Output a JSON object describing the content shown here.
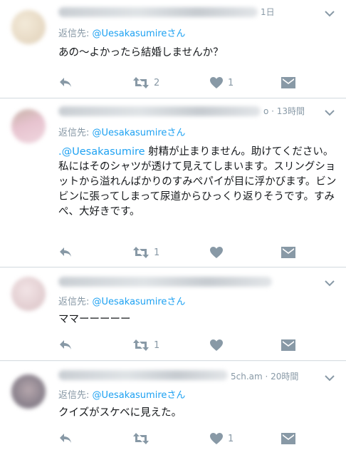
{
  "tweets": [
    {
      "time": "1日",
      "reply_prefix": "返信先: ",
      "reply_handle": "@Uesakasumire",
      "reply_suffix": "さん",
      "text": "あの〜よかったら結婚しませんか？",
      "retweets": "2",
      "likes": "1",
      "avatar_color": "#e9dcc7"
    },
    {
      "time": "o · 13時間",
      "reply_prefix": "返信先: ",
      "reply_handle": "@Uesakasumire",
      "reply_suffix": "さん",
      "mention": ".@Uesakasumire",
      "text": " 射精が止まりません。助けてください。\n私にはそのシャツが透けて見えてしまいます。スリングショットから溢れんばかりのすみぺパイが目に浮かびます。ビンビンに張ってしまって尿道からひっくり返りそうです。すみぺ、大好きです。",
      "retweets": "1",
      "likes": "",
      "avatar_color": "#d9b9c2"
    },
    {
      "time": "",
      "reply_prefix": "返信先: ",
      "reply_handle": "@Uesakasumire",
      "reply_suffix": "さん",
      "text": "ママーーーーー",
      "retweets": "1",
      "likes": "",
      "avatar_color": "#e6d2d4"
    },
    {
      "time": "5ch.am · 20時間",
      "reply_prefix": "返信先: ",
      "reply_handle": "@Uesakasumire",
      "reply_suffix": "さん",
      "text": "クイズがスケベに見えた。",
      "retweets": "",
      "likes": "1",
      "avatar_color": "#8f8a94"
    }
  ],
  "colors": {
    "link": "#1da1f2",
    "muted": "#8899a6",
    "text": "#14171a"
  },
  "icons": [
    "reply-icon",
    "retweet-icon",
    "like-icon",
    "direct-message-icon",
    "chevron-down-icon"
  ]
}
